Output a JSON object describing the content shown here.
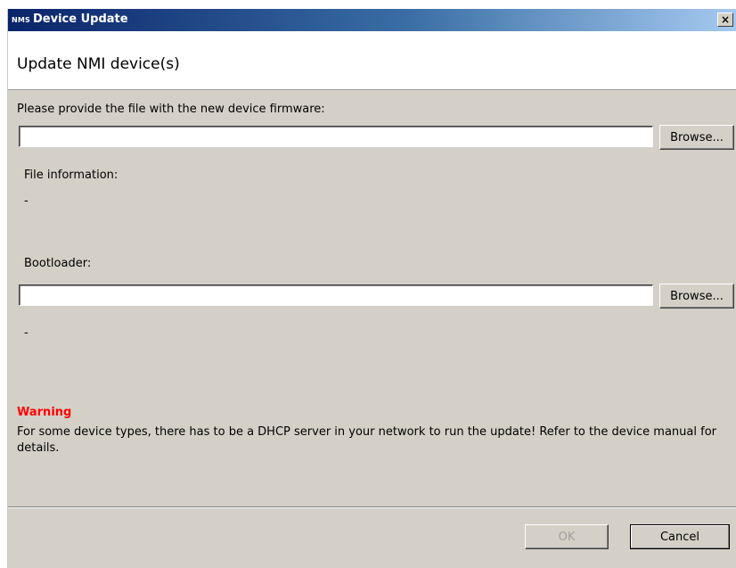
{
  "window": {
    "app_icon": "NMS",
    "title": "Device Update",
    "close_glyph": "×"
  },
  "header": {
    "title": "Update NMI device(s)"
  },
  "firmware": {
    "prompt": "Please provide the file with the new device firmware:",
    "value": "",
    "browse_label": "Browse...",
    "info_label": "File information:",
    "info_value": "-"
  },
  "bootloader": {
    "label": "Bootloader:",
    "value": "",
    "browse_label": "Browse...",
    "info_value": "-"
  },
  "warning": {
    "title": "Warning",
    "text": "For some device types, there has to be a DHCP server in your network to run the update! Refer to the device manual for details."
  },
  "footer": {
    "ok_label": "OK",
    "cancel_label": "Cancel"
  },
  "colors": {
    "dialog_bg": "#d4d0c8",
    "title_gradient_start": "#0a246a",
    "title_gradient_end": "#a6caf0",
    "warning": "#ff0000"
  }
}
